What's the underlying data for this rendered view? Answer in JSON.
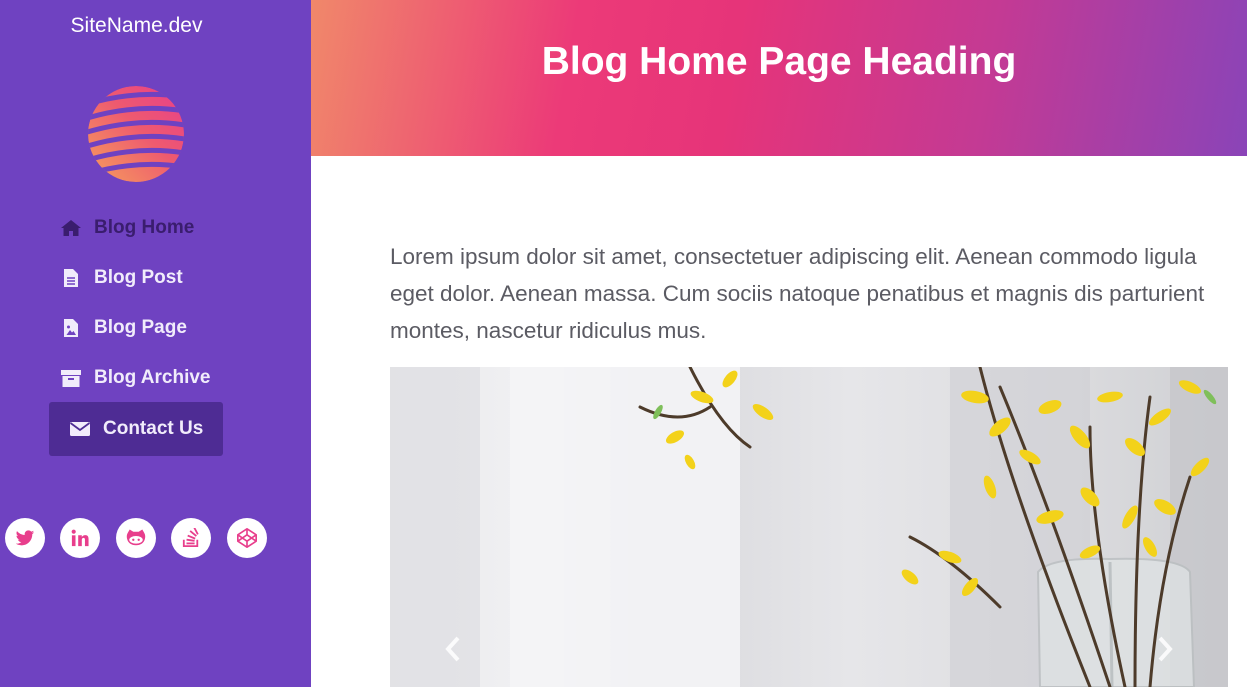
{
  "site": {
    "name": "SiteName.dev",
    "logo_icon": "striped-globe-logo"
  },
  "nav": {
    "items": [
      {
        "label": "Blog Home",
        "icon": "home-icon"
      },
      {
        "label": "Blog Post",
        "icon": "file-text-icon"
      },
      {
        "label": "Blog Page",
        "icon": "file-image-icon"
      },
      {
        "label": "Blog Archive",
        "icon": "archive-icon"
      },
      {
        "label": "Contact Us",
        "icon": "envelope-icon"
      }
    ]
  },
  "social": [
    "twitter-icon",
    "linkedin-icon",
    "github-icon",
    "stackoverflow-icon",
    "codepen-icon"
  ],
  "header": {
    "title": "Blog Home Page Heading"
  },
  "main": {
    "intro": "Lorem ipsum dolor sit amet, consectetuer adipiscing elit. Aenean commodo ligula eget dolor. Aenean massa. Cum sociis natoque penatibus et magnis dis parturient montes, nascetur ridiculus mus."
  },
  "colors": {
    "sidebar": "#6f42c1",
    "active_nav": "#4e2c94",
    "accent_pink": "#e83e8c",
    "gradient_start": "#f0886a",
    "gradient_end": "#8a44b8"
  }
}
